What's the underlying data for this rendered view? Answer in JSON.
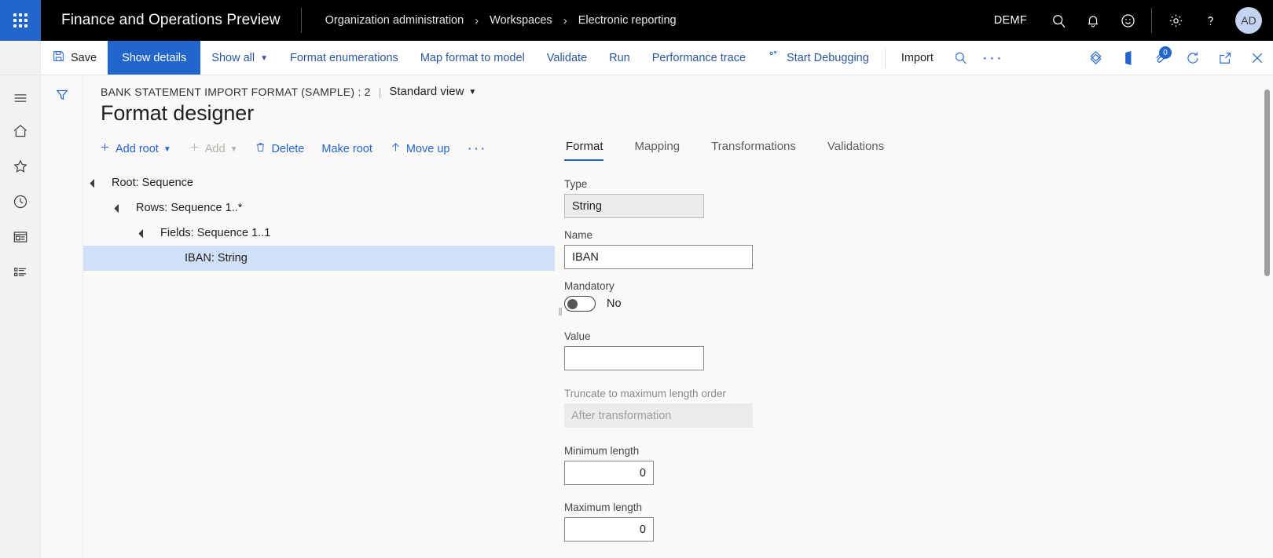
{
  "topbar": {
    "waffle_icon": "app-launcher-icon",
    "app_title": "Finance and Operations Preview",
    "breadcrumb": [
      {
        "label": "Organization administration"
      },
      {
        "label": "Workspaces"
      },
      {
        "label": "Electronic reporting"
      }
    ],
    "breadcrumb_separator": "›",
    "company": "DEMF",
    "icons": [
      {
        "name": "search-icon"
      },
      {
        "name": "notifications-bell-icon"
      },
      {
        "name": "feedback-smiley-icon"
      },
      {
        "name": "settings-gear-icon"
      },
      {
        "name": "help-question-icon"
      }
    ],
    "avatar_initials": "AD",
    "accent_blue": "#2266cc",
    "bar_background": "#000000"
  },
  "commandbar": {
    "items": [
      {
        "label": "Save",
        "icon": "save-disk-icon",
        "style": "dark"
      },
      {
        "label": "Show details",
        "style": "active"
      },
      {
        "label": "Show all",
        "style": "link",
        "caret": true
      },
      {
        "label": "Format enumerations",
        "style": "link"
      },
      {
        "label": "Map format to model",
        "style": "link"
      },
      {
        "label": "Validate",
        "style": "link"
      },
      {
        "label": "Run",
        "style": "link"
      },
      {
        "label": "Performance trace",
        "style": "link"
      },
      {
        "label": "Start Debugging",
        "style": "link",
        "icon": "debug-icon"
      },
      {
        "label": "Import",
        "style": "dark"
      }
    ],
    "right_icons": [
      {
        "name": "search-icon"
      },
      {
        "name": "overflow-ellipsis-icon"
      },
      {
        "name": "personalize-diamond-icon"
      },
      {
        "name": "open-in-office-icon"
      },
      {
        "name": "attachments-icon",
        "badge": "0"
      },
      {
        "name": "refresh-icon"
      },
      {
        "name": "popout-icon"
      },
      {
        "name": "close-icon"
      }
    ]
  },
  "leftnav": {
    "items": [
      {
        "name": "hamburger-menu-icon"
      },
      {
        "name": "home-icon"
      },
      {
        "name": "favorites-star-icon"
      },
      {
        "name": "recent-clock-icon"
      },
      {
        "name": "workspaces-icon"
      },
      {
        "name": "modules-list-icon"
      }
    ]
  },
  "filterpane": {
    "icon": "filter-funnel-icon"
  },
  "page": {
    "caption": "BANK STATEMENT IMPORT FORMAT (SAMPLE) : 2",
    "separator": "|",
    "view_selector": "Standard view",
    "title": "Format designer"
  },
  "tree_toolbar": {
    "items": [
      {
        "label": "Add root",
        "icon": "plus-icon",
        "caret": true,
        "disabled": false
      },
      {
        "label": "Add",
        "icon": "plus-icon",
        "caret": true,
        "disabled": true
      },
      {
        "label": "Delete",
        "icon": "trash-icon",
        "disabled": false
      },
      {
        "label": "Make root",
        "disabled": false
      },
      {
        "label": "Move up",
        "icon": "arrow-up-icon",
        "disabled": false
      },
      {
        "label": "···",
        "disabled": false
      }
    ]
  },
  "tree": {
    "rows": [
      {
        "label": "Root: Sequence",
        "depth": 0,
        "expanded": true,
        "selected": false
      },
      {
        "label": "Rows: Sequence 1..*",
        "depth": 1,
        "expanded": true,
        "selected": false
      },
      {
        "label": "Fields: Sequence 1..1",
        "depth": 2,
        "expanded": true,
        "selected": false
      },
      {
        "label": "IBAN: String",
        "depth": 3,
        "expanded": false,
        "selected": true
      }
    ]
  },
  "detail": {
    "tabs": [
      {
        "label": "Format",
        "active": true
      },
      {
        "label": "Mapping",
        "active": false
      },
      {
        "label": "Transformations",
        "active": false
      },
      {
        "label": "Validations",
        "active": false
      }
    ],
    "fields": {
      "type": {
        "label": "Type",
        "value": "String"
      },
      "name": {
        "label": "Name",
        "value": "IBAN"
      },
      "mandatory": {
        "label": "Mandatory",
        "value": "No",
        "on": false
      },
      "value": {
        "label": "Value",
        "value": ""
      },
      "truncate": {
        "label": "Truncate to maximum length order",
        "value": "After transformation",
        "disabled": true
      },
      "minimum_length": {
        "label": "Minimum length",
        "value": "0"
      },
      "maximum_length": {
        "label": "Maximum length",
        "value": "0"
      }
    }
  }
}
